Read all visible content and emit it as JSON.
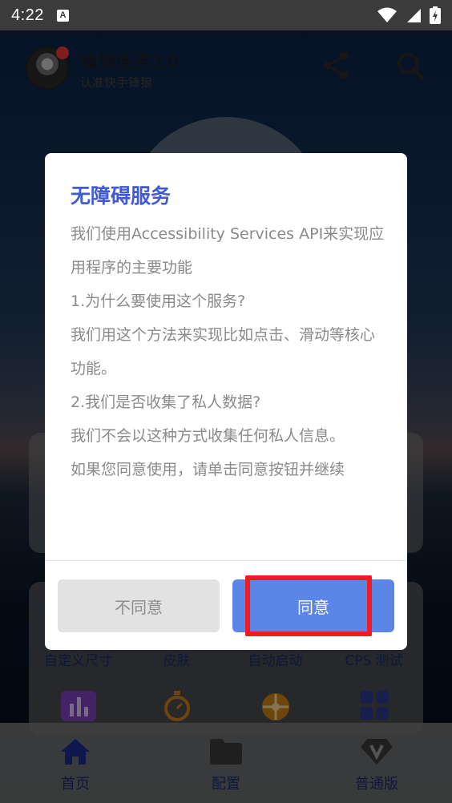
{
  "status_bar": {
    "time": "4:22",
    "notification_icon": "a-letter-icon",
    "icons": [
      "wifi-icon",
      "signal-icon",
      "battery-icon"
    ]
  },
  "app_header": {
    "title": "锋狼连点3.0",
    "subtitle": "认准快手锋狼",
    "icons": [
      "share-icon",
      "search-icon"
    ]
  },
  "features": {
    "labels": [
      "自定义尺寸",
      "皮肤",
      "自动启动",
      "CPS 测试"
    ],
    "icons": [
      "chart-icon",
      "stopwatch-icon",
      "wheel-icon",
      "grid-icon"
    ]
  },
  "bottom_nav": {
    "items": [
      {
        "label": "首页",
        "icon": "home-icon"
      },
      {
        "label": "配置",
        "icon": "folder-icon"
      },
      {
        "label": "普通版",
        "icon": "diamond-v-icon"
      }
    ]
  },
  "dialog": {
    "title": "无障碍服务",
    "paragraphs": [
      "我们使用Accessibility Services API来实现应用程序的主要功能",
      "1.为什么要使用这个服务?",
      "我们用这个方法来实现比如点击、滑动等核心功能。",
      "2.我们是否收集了私人数据?",
      "我们不会以这种方式收集任何私人信息。",
      "如果您同意使用，请单击同意按钮并继续"
    ],
    "disagree_label": "不同意",
    "agree_label": "同意"
  },
  "colors": {
    "title_blue": "#3f5ad4",
    "agree_button": "#5b86e8",
    "highlight_red": "#ee1c24",
    "nav_text": "#1c2c6a"
  }
}
